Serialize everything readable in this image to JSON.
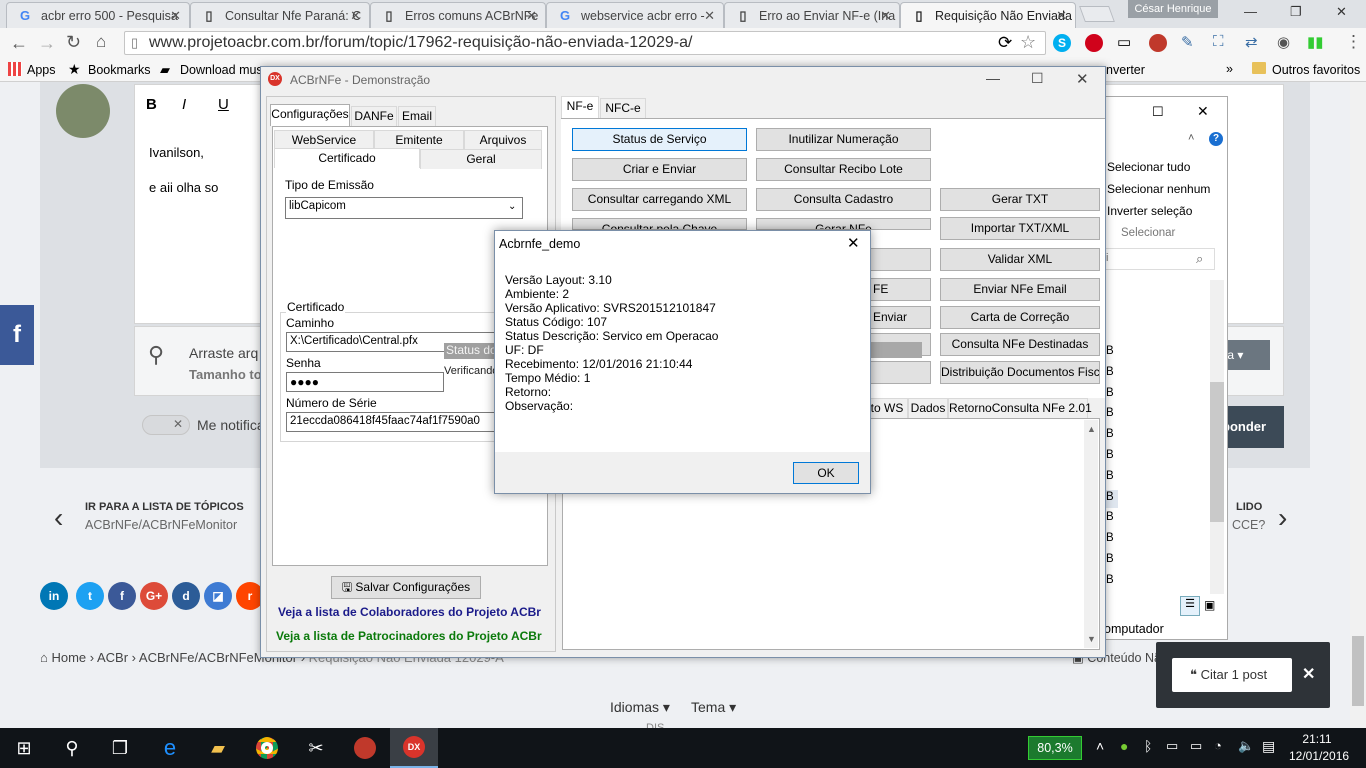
{
  "browser": {
    "tabs": [
      {
        "label": "acbr erro 500 - Pesquisa",
        "icon": "G"
      },
      {
        "label": "Consultar Nfe Paraná: C",
        "icon": "doc"
      },
      {
        "label": "Erros comuns ACBrNFe",
        "icon": "doc"
      },
      {
        "label": "webservice acbr erro -",
        "icon": "G"
      },
      {
        "label": "Erro ao Enviar NF-e (Ina",
        "icon": "doc"
      },
      {
        "label": "Requisição Não Enviada",
        "icon": "doc"
      }
    ],
    "user": "César Henrique",
    "url": "www.projetoacbr.com.br/forum/topic/17962-requisição-não-enviada-12029-a/",
    "bookmarks": {
      "apps": "Apps",
      "bookmarks": "Bookmarks",
      "download": "Download mus",
      "inverter": "nverter",
      "outros": "Outros favoritos"
    }
  },
  "forum": {
    "editor_text1": "Ivanilson,",
    "editor_text2": "e aii olha so",
    "attach_label": "Arraste arq",
    "attach_sub": "Tamanho to",
    "notify_label": "Me notifica",
    "nav_top": "IR PARA A LISTA DE TÓPICOS",
    "nav_sub": "ACBrNFe/ACBrNFeMonitor",
    "next_top": "LIDO",
    "next_sub": "CCE?",
    "breadcrumb": [
      "Home",
      "ACBr",
      "ACBrNFe/ACBrNFeMonitor",
      "Requisição Não Enviada 12029-A"
    ],
    "content_label": "Conteúdo Nã",
    "footer_idiomas": "Idiomas",
    "footer_tema": "Tema",
    "footer_cut": "DIS ",
    "quote_button": "Citar 1 post",
    "reply_button": "ponder",
    "media_button": "nídia"
  },
  "explorer": {
    "select_all": "Selecionar tudo",
    "select_none": "Selecionar nenhum",
    "invert": "Inverter seleção",
    "group": "Selecionar",
    "computer": "omputador",
    "rows": [
      "B",
      "B",
      "B",
      "B",
      "B",
      "B",
      "B",
      "B",
      "B",
      "B",
      "B",
      "B"
    ]
  },
  "app": {
    "title": "ACBrNFe - Demonstração",
    "left_tabs": [
      "Configurações",
      "DANFe",
      "Email"
    ],
    "sub_tabs_row1": [
      "WebService",
      "Emitente",
      "Arquivos"
    ],
    "sub_tabs_row2": [
      "Certificado",
      "Geral"
    ],
    "tipo_emissao_label": "Tipo de Emissão",
    "tipo_emissao_value": "libCapicom",
    "cert_group": "Certificado",
    "caminho_label": "Caminho",
    "caminho_value": "X:\\Certificado\\Central.pfx",
    "status_overlay": "Status do",
    "verificando": "Verificando",
    "senha_label": "Senha",
    "senha_value": "●●●●",
    "serie_label": "Número de Série",
    "serie_value": "21eccda086418f45faac74af1f7590a0",
    "save_button": "Salvar Configurações",
    "link1": "Veja a lista de Colaboradores do Projeto ACBr",
    "link2": "Veja a lista de Patrocinadores do Projeto ACBr",
    "right_tabs": [
      "NF-e",
      "NFC-e"
    ],
    "buttons": {
      "status_servico": "Status de Serviço",
      "inutilizar": "Inutilizar Numeração",
      "criar_enviar": "Criar e Enviar",
      "consultar_recibo": "Consultar Recibo Lote",
      "consultar_xml": "Consultar carregando XML",
      "consulta_cadastro": "Consulta Cadastro",
      "gerar_txt": "Gerar TXT",
      "consultar_chave": "Consultar pela Chave",
      "gerar_nfe": "Gerar NFe",
      "importar_txt": "Importar TXT/XML",
      "validar_xml": "Validar XML",
      "fe_partial": "FE",
      "enviar_email": "Enviar NFe Email",
      "enviar_partial": "Enviar",
      "carta_correcao": "Carta de Correção",
      "consulta_destinadas": "Consulta NFe Destinadas",
      "distribuicao": "Distribuição Documentos Fiscais"
    },
    "result_tabs": [
      "to WS",
      "Dados",
      "RetornoConsulta NFe 2.01"
    ]
  },
  "dialog": {
    "title": "Acbrnfe_demo",
    "lines": [
      "Versão Layout: 3.10",
      "Ambiente: 2",
      "Versão Aplicativo: SVRS201512101847",
      "Status Código: 107",
      "Status Descrição: Servico em Operacao",
      "UF: DF",
      "Recebimento: 12/01/2016 21:10:44",
      "Tempo Médio: 1",
      "Retorno:",
      "Observação:"
    ],
    "ok": "OK"
  },
  "taskbar": {
    "battery": "80,3%",
    "time": "21:11",
    "date": "12/01/2016"
  },
  "colors": {
    "accent": "#0078d7",
    "taskbar": "#101418",
    "link1": "#1b1b8a",
    "link2": "#0b7a0b"
  }
}
